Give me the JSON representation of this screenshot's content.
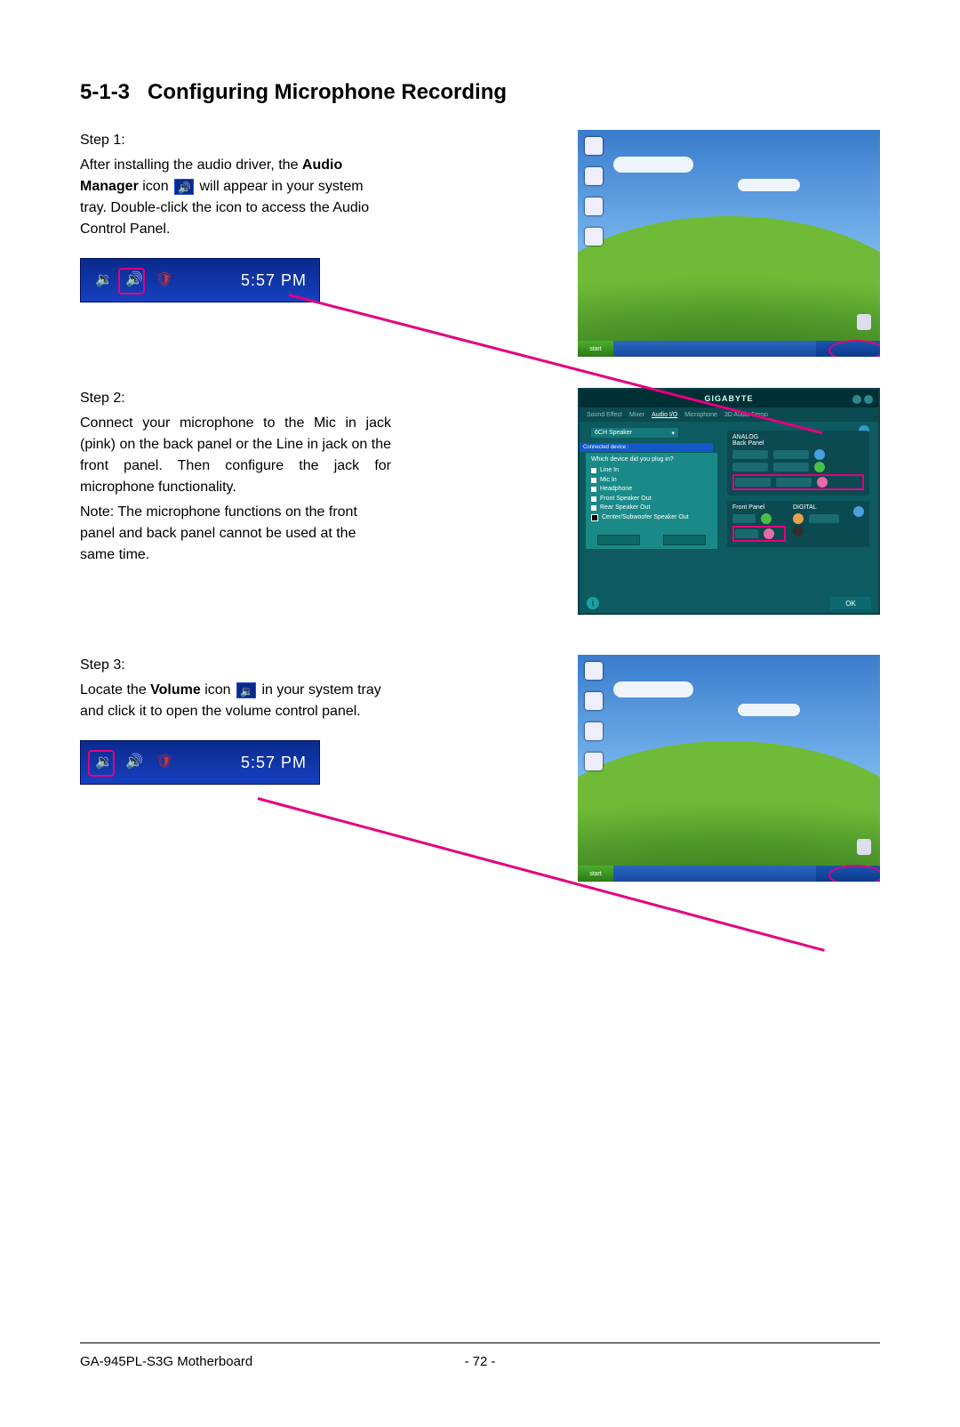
{
  "header": {
    "section_number": "5-1-3",
    "section_title": "Configuring Microphone Recording"
  },
  "step1": {
    "label": "Step 1:",
    "text_a": "After installing the audio driver, the ",
    "bold_a": "Audio Manager",
    "text_b": " icon ",
    "text_c": " will appear in your system tray. Double-click the icon to access the Audio Control Panel."
  },
  "step2": {
    "label": "Step 2:",
    "text_a": "Connect your microphone to the Mic in jack (pink) on the back panel or the Line in jack on the front panel. Then configure the jack for microphone functionality.",
    "text_b": "Note: The microphone functions on the front panel and back panel cannot be used at the same time."
  },
  "step3": {
    "label": "Step 3:",
    "text_a": "Locate the ",
    "bold_a": "Volume",
    "text_b": " icon ",
    "text_c": " in your system tray and click it to open the volume control panel."
  },
  "tray": {
    "time": "5:57 PM"
  },
  "desktop": {
    "start": "start"
  },
  "audio_panel": {
    "title": "GIGABYTE",
    "tabs": [
      "Sound Effect",
      "Mixer",
      "Audio I/O",
      "Microphone",
      "3D Audio Demo"
    ],
    "active_tab": 2,
    "dropdown": "6CH Speaker",
    "connected_label": "Connected device :",
    "popup_title": "Which device did you plug in?",
    "popup_options": [
      "Line In",
      "Mic In",
      "Headphone",
      "Front Speaker Out",
      "Rear Speaker Out",
      "Center/Subwoofer Speaker Out"
    ],
    "popup_selected": 5,
    "analog_label": "ANALOG",
    "back_panel_label": "Back Panel",
    "front_panel_label": "Front Panel",
    "digital_label": "DIGITAL",
    "ok": "OK"
  },
  "footer": {
    "model": "GA-945PL-S3G Motherboard",
    "page": "- 72 -"
  }
}
